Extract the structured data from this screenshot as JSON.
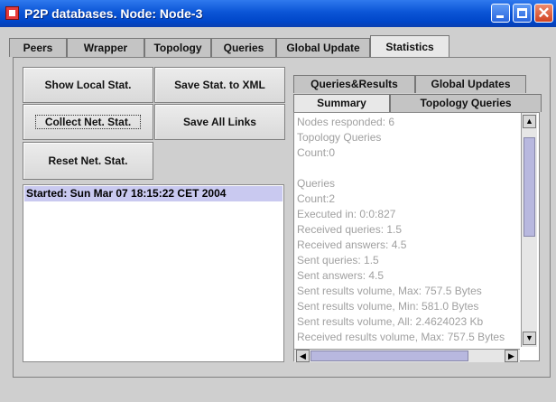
{
  "window": {
    "title": "P2P databases. Node: Node-3"
  },
  "tabs": [
    "Peers",
    "Wrapper",
    "Topology",
    "Queries",
    "Global Update",
    "Statistics"
  ],
  "active_tab": "Statistics",
  "buttons": {
    "show_local": "Show Local Stat.",
    "save_xml": "Save Stat. to XML",
    "collect_net": "Collect Net. Stat.",
    "save_links": "Save All Links",
    "reset_net": "Reset Net. Stat."
  },
  "log": {
    "line": "Started: Sun Mar 07 18:15:22 CET 2004"
  },
  "subtabs": {
    "row_back": [
      "Queries&Results",
      "Global Updates"
    ],
    "row_front": [
      "Summary",
      "Topology Queries"
    ],
    "active": "Summary"
  },
  "summary_lines": [
    "Nodes responded: 6",
    "Topology Queries",
    " Count:0",
    "",
    "Queries",
    " Count:2",
    " Executed in: 0:0:827",
    " Received  queries: 1.5",
    " Received answers: 4.5",
    " Sent queries: 1.5",
    " Sent answers: 4.5",
    " Sent results volume, Max: 757.5 Bytes",
    " Sent results volume, Min: 581.0 Bytes",
    " Sent results volume, All: 2.4624023 Kb",
    " Received results volume, Max: 757.5 Bytes"
  ],
  "colors": {
    "title_bar": "#0b55d6",
    "log_highlight": "#c9c9f0",
    "scroll_thumb": "#b8b8df"
  },
  "icons": {
    "app": "app-icon",
    "minimize": "minimize-icon",
    "maximize": "maximize-icon",
    "close": "close-icon"
  }
}
